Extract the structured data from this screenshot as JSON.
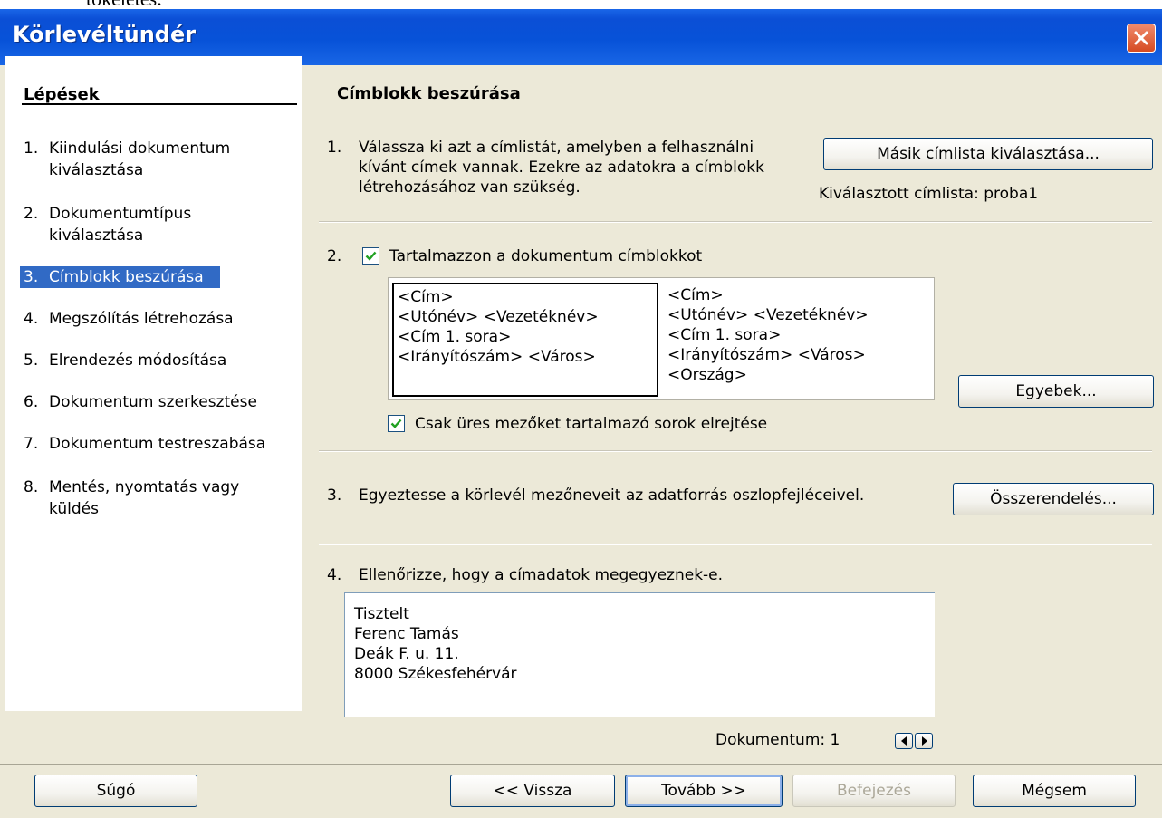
{
  "top_fragment": "tökéletes.",
  "window": {
    "title": "Körlevéltündér"
  },
  "steps": {
    "heading": "Lépések",
    "items": [
      {
        "num": "1.",
        "label": "Kiindulási dokumentum\nkiválasztása"
      },
      {
        "num": "2.",
        "label": "Dokumentumtípus\nkiválasztása"
      },
      {
        "num": "3.",
        "label": "Címblokk beszúrása"
      },
      {
        "num": "4.",
        "label": "Megszólítás létrehozása"
      },
      {
        "num": "5.",
        "label": "Elrendezés módosítása"
      },
      {
        "num": "6.",
        "label": "Dokumentum szerkesztése"
      },
      {
        "num": "7.",
        "label": "Dokumentum testreszabása"
      },
      {
        "num": "8.",
        "label": "Mentés, nyomtatás vagy\nküldés"
      }
    ],
    "active_index": 2
  },
  "main": {
    "title": "Címblokk beszúrása",
    "s1": {
      "num": "1.",
      "text": "Válassza ki azt a címlistát, amelyben a felhasználni\nkívánt címek vannak. Ezekre az adatokra a címblokk\nlétrehozásához van szükség.",
      "button": "Másik címlista kiválasztása...",
      "selected_label": "Kiválasztott címlista: proba1"
    },
    "s2": {
      "num": "2.",
      "checkbox_label": "Tartalmazzon a dokumentum címblokkot",
      "checked": true,
      "block1": "<Cím>\n<Utónév> <Vezetéknév>\n<Cím 1. sora>\n<Irányítószám> <Város>",
      "block2": "<Cím>\n<Utónév> <Vezetéknév>\n<Cím 1. sora>\n<Irányítószám> <Város>\n<Ország>",
      "more_button": "Egyebek...",
      "hide_checkbox_label": "Csak üres mezőket tartalmazó sorok elrejtése",
      "hide_checked": true
    },
    "s3": {
      "num": "3.",
      "text": "Egyeztesse a körlevél mezőneveit az adatforrás oszlopfejléceivel.",
      "button": "Összerendelés..."
    },
    "s4": {
      "num": "4.",
      "text": "Ellenőrizze, hogy a címadatok megegyeznek-e.",
      "preview": "Tisztelt\nFerenc Tamás\nDeák F. u. 11.\n8000 Székesfehérvár",
      "doc_label": "Dokumentum: 1"
    }
  },
  "footer": {
    "help": "Súgó",
    "back": "<< Vissza",
    "next": "Tovább >>",
    "finish": "Befejezés",
    "cancel": "Mégsem"
  },
  "icons": {
    "close": "close-icon",
    "check": "check-icon",
    "prev": "triangle-left-icon",
    "next": "triangle-right-icon"
  },
  "colors": {
    "titlebar": "#0752d8",
    "selection": "#316ac5",
    "dialog_bg": "#ece9d8",
    "close_red": "#d54b22"
  }
}
